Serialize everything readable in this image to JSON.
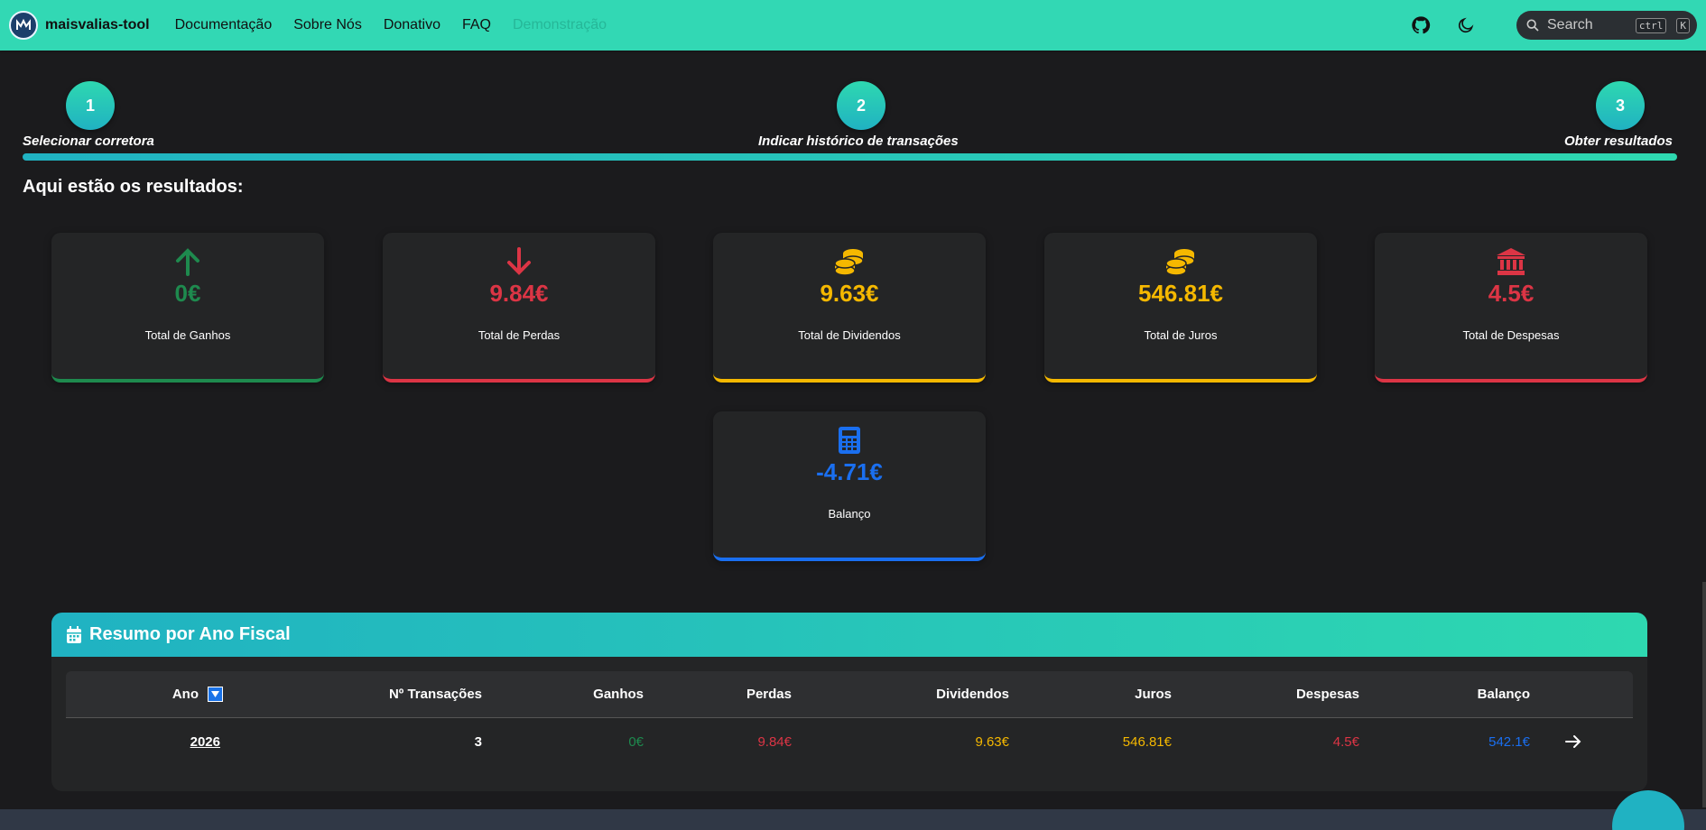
{
  "navbar": {
    "brand": "maisvalias-tool",
    "links": [
      "Documentação",
      "Sobre Nós",
      "Donativo",
      "FAQ",
      "Demonstração"
    ],
    "search_placeholder": "Search",
    "shortcut_keys": [
      "ctrl",
      "K"
    ],
    "bg_color": "#32d8b4"
  },
  "stepper": {
    "steps": [
      {
        "number": "1",
        "label": "Selecionar corretora"
      },
      {
        "number": "2",
        "label": "Indicar histórico de transações"
      },
      {
        "number": "3",
        "label": "Obter resultados"
      }
    ]
  },
  "results": {
    "title": "Aqui estão os resultados:",
    "cards": [
      {
        "value": "0€",
        "label": "Total de Ganhos",
        "icon": "arrow-up-icon",
        "color": "#1e8a4e"
      },
      {
        "value": "9.84€",
        "label": "Total de Perdas",
        "icon": "arrow-down-icon",
        "color": "#dc3545"
      },
      {
        "value": "9.63€",
        "label": "Total de Dividendos",
        "icon": "coins-icon",
        "color": "#f5b800"
      },
      {
        "value": "546.81€",
        "label": "Total de Juros",
        "icon": "coins-icon",
        "color": "#f5b800"
      },
      {
        "value": "4.5€",
        "label": "Total de Despesas",
        "icon": "bank-icon",
        "color": "#dc3545"
      },
      {
        "value": "-4.71€",
        "label": "Balanço",
        "icon": "calculator-icon",
        "color": "#1a6ff0"
      }
    ]
  },
  "fiscal_summary": {
    "title": "Resumo por Ano Fiscal",
    "columns": [
      "Ano",
      "Nº Transações",
      "Ganhos",
      "Perdas",
      "Dividendos",
      "Juros",
      "Despesas",
      "Balanço"
    ],
    "rows": [
      {
        "ano": "2026",
        "transacoes": "3",
        "ganhos": "0€",
        "perdas": "9.84€",
        "dividendos": "9.63€",
        "juros": "546.81€",
        "despesas": "4.5€",
        "balanco": "542.1€"
      }
    ]
  }
}
